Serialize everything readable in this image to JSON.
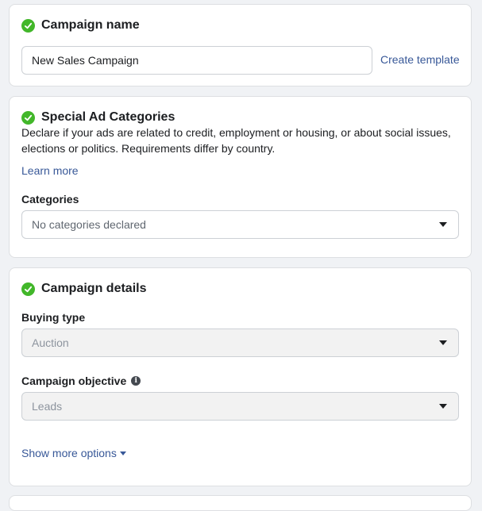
{
  "campaign_name_section": {
    "title": "Campaign name",
    "input_value": "New Sales Campaign",
    "create_template_link": "Create template"
  },
  "special_ad_section": {
    "title": "Special Ad Categories",
    "description": "Declare if your ads are related to credit, employment or housing, or about social issues, elections or politics. Requirements differ by country.",
    "learn_more_link": "Learn more",
    "categories_label": "Categories",
    "categories_value": "No categories declared"
  },
  "campaign_details_section": {
    "title": "Campaign details",
    "buying_type_label": "Buying type",
    "buying_type_value": "Auction",
    "objective_label": "Campaign objective",
    "objective_value": "Leads",
    "show_more_link": "Show more options"
  },
  "icons": {
    "status": "check-circle-icon",
    "dropdown": "caret-down-icon",
    "info": "info-icon"
  },
  "colors": {
    "check_green": "#42b72a",
    "link_blue": "#385898",
    "page_bg": "#f0f2f5"
  }
}
